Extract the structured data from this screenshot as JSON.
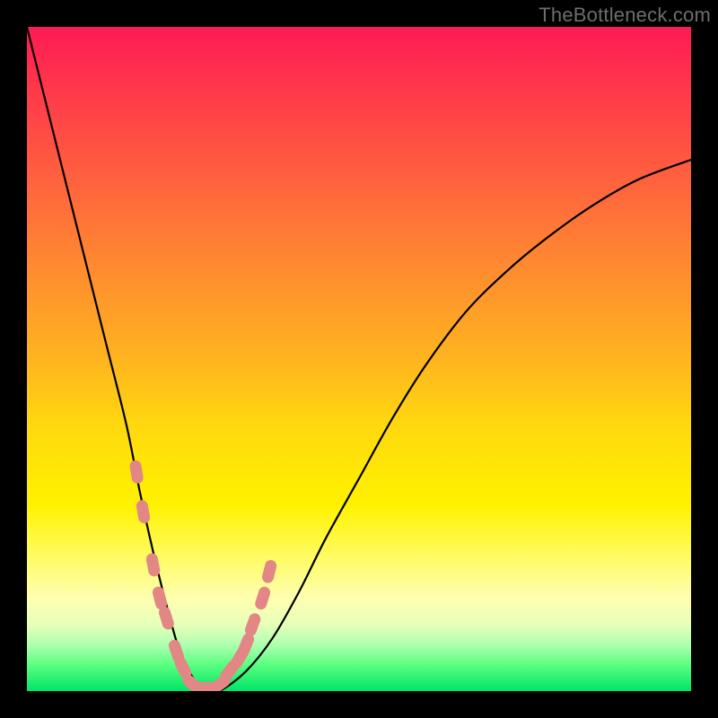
{
  "watermark": "TheBottleneck.com",
  "colors": {
    "background_frame": "#000000",
    "gradient_top": "#ff1a55",
    "gradient_bottom": "#00e566",
    "curve": "#000000",
    "marker_fill": "#e38686",
    "marker_stroke": "#cc6f6f"
  },
  "chart_data": {
    "type": "line",
    "title": "",
    "xlabel": "",
    "ylabel": "",
    "xlim": [
      0,
      100
    ],
    "ylim": [
      0,
      100
    ],
    "grid": false,
    "legend": false,
    "series": [
      {
        "name": "bottleneck-curve",
        "x": [
          0,
          3,
          6,
          9,
          12,
          15,
          17,
          19,
          21,
          23,
          25,
          27,
          29,
          33,
          37,
          41,
          45,
          50,
          55,
          60,
          66,
          72,
          78,
          85,
          92,
          100
        ],
        "y": [
          100,
          88,
          76,
          64,
          52,
          40,
          30,
          21,
          13,
          6,
          2,
          0,
          0,
          3,
          8,
          15,
          23,
          32,
          41,
          49,
          57,
          63,
          68,
          73,
          77,
          80
        ]
      }
    ],
    "markers": {
      "name": "highlight-dots",
      "x": [
        16.5,
        17.5,
        19,
        20,
        21,
        22.5,
        23.5,
        25,
        27,
        29,
        30.5,
        32,
        33,
        34,
        35.5,
        36.5
      ],
      "y": [
        33,
        27,
        19,
        14,
        11,
        6,
        3.5,
        1,
        0.5,
        1,
        3,
        5,
        7,
        10,
        14,
        18
      ]
    }
  }
}
